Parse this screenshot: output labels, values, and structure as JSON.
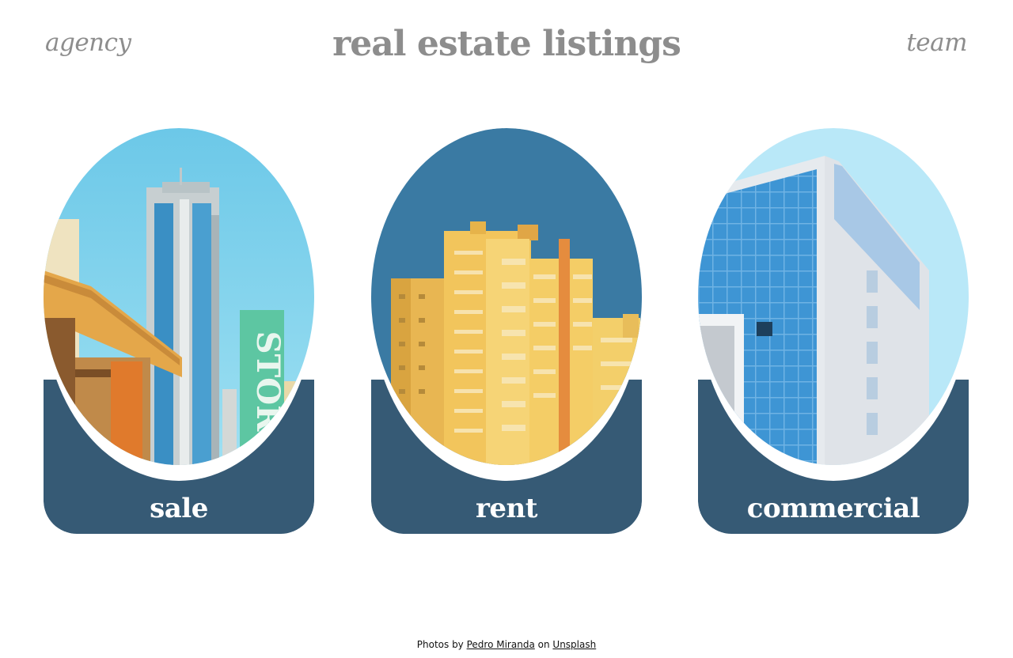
{
  "nav": {
    "left_link": "agency",
    "right_link": "team"
  },
  "title": "real estate listings",
  "cards": [
    {
      "label": "sale"
    },
    {
      "label": "rent"
    },
    {
      "label": "commercial"
    }
  ],
  "sign_text": "STOR",
  "footer": {
    "prefix": "Photos by",
    "author": "Pedro Miranda",
    "middle": "on",
    "source": "Unsplash"
  },
  "colors": {
    "card_base": "#365a75",
    "heading": "#8d8d8d",
    "background": "#ffffff"
  }
}
